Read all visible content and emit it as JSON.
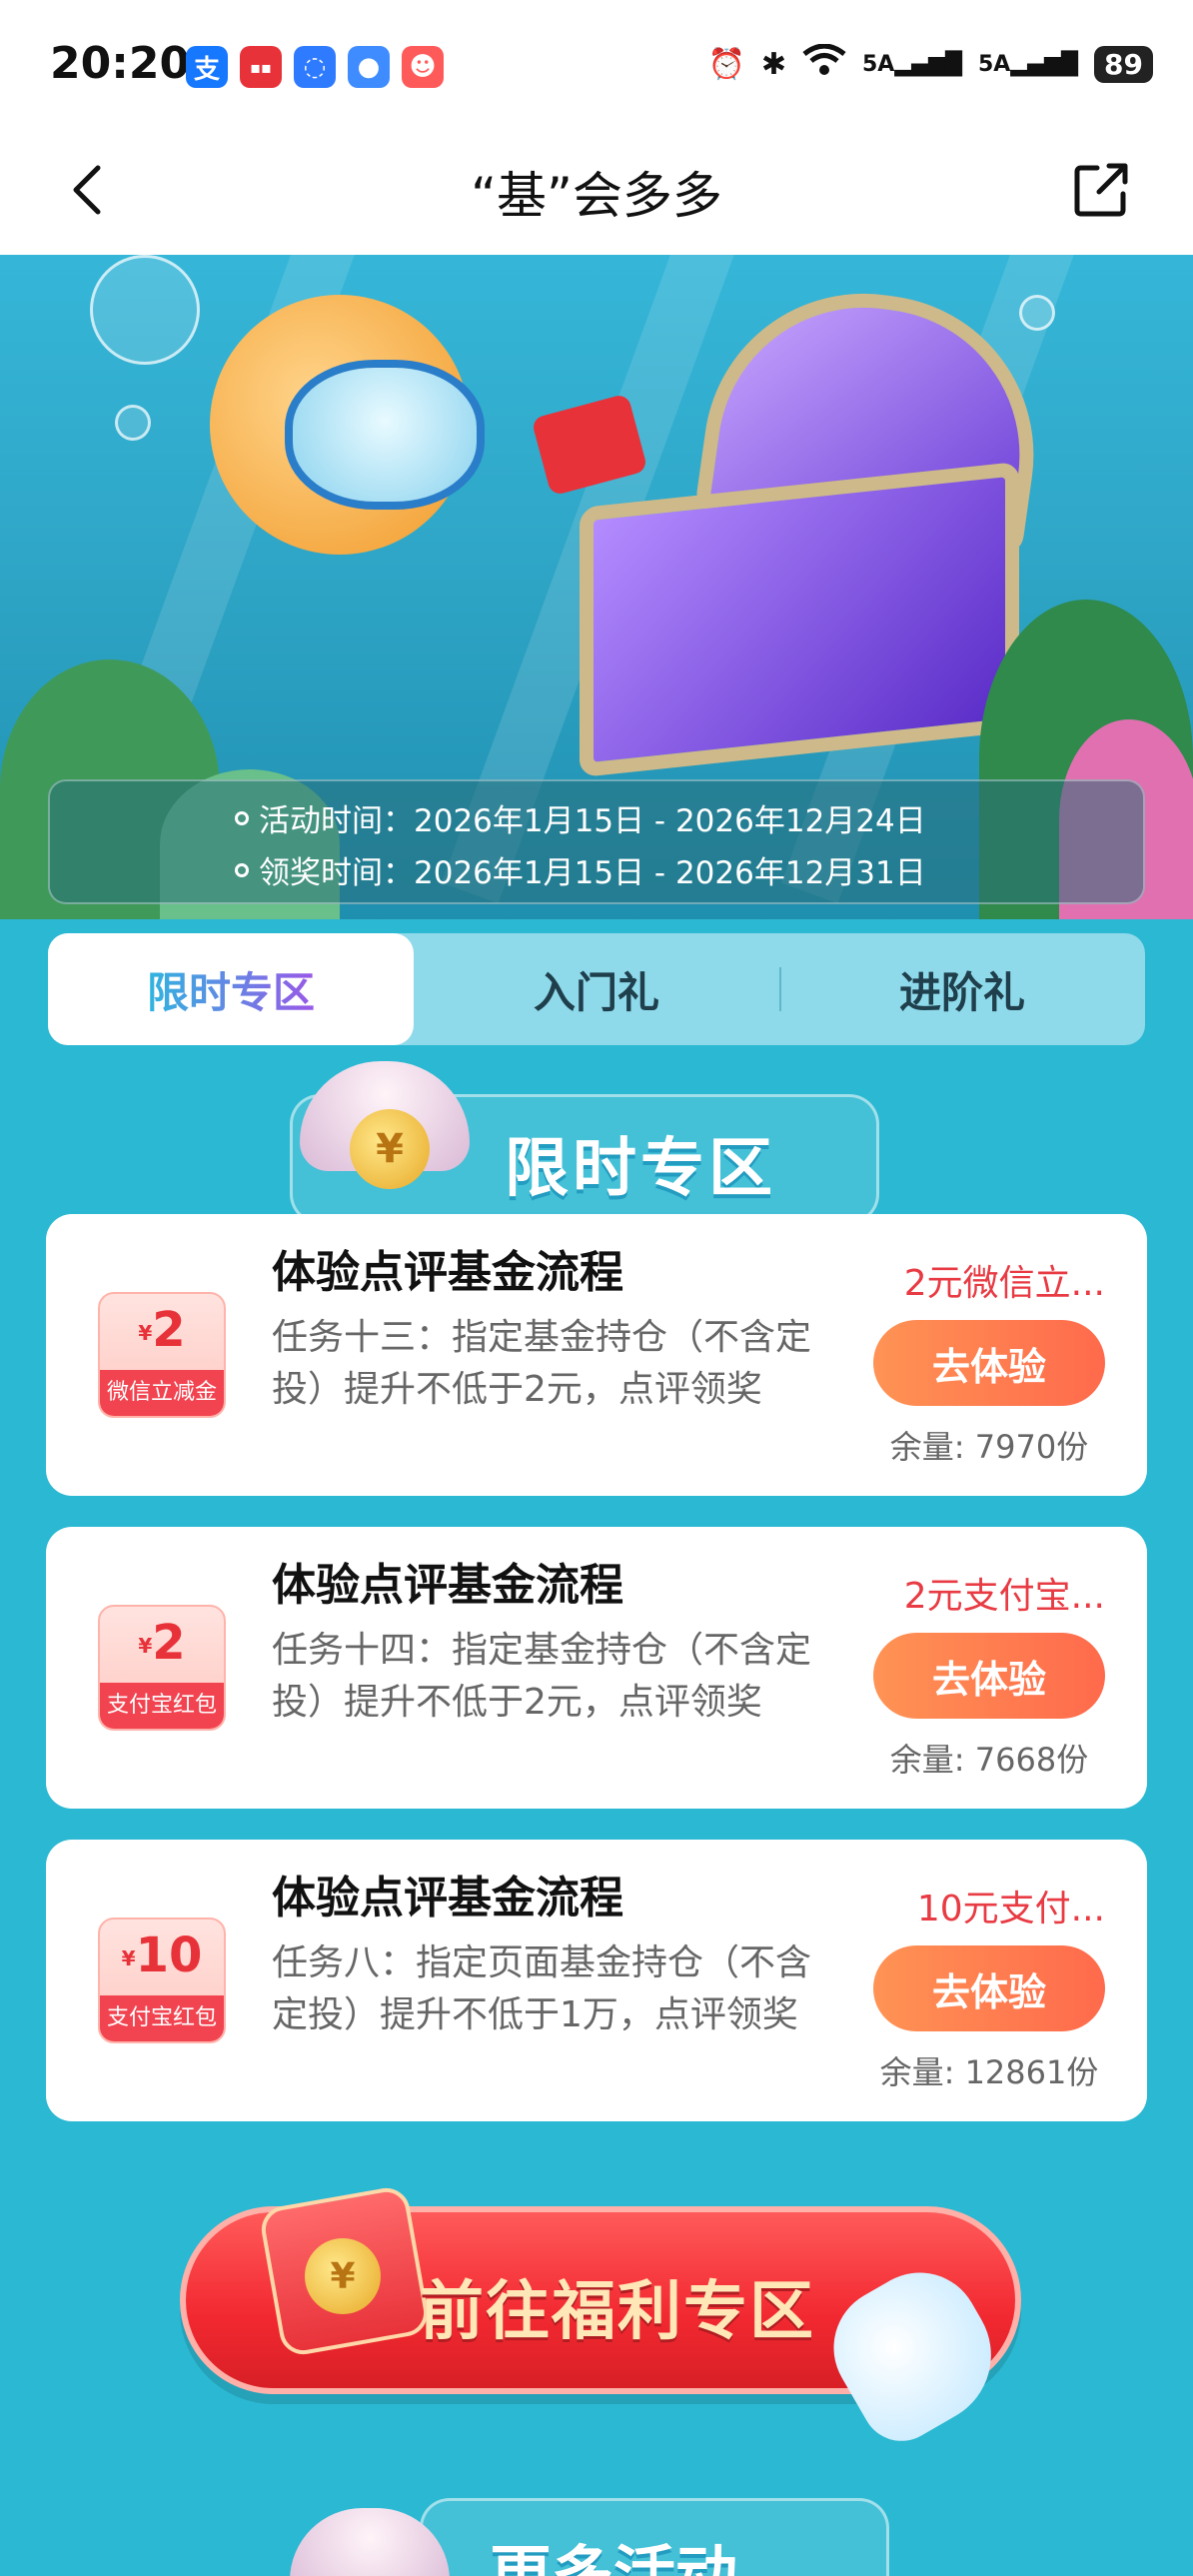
{
  "status_bar": {
    "time": "20:20",
    "battery": "89",
    "signal_1": "5A",
    "signal_2": "5A"
  },
  "nav": {
    "title": "“基”会多多"
  },
  "activity": {
    "activity_time": "活动时间：2026年1月15日 - 2026年12月24日",
    "claim_time": "领奖时间：2026年1月15日 - 2026年12月31日"
  },
  "tabs": [
    {
      "label": "限时专区",
      "active": true
    },
    {
      "label": "入门礼",
      "active": false
    },
    {
      "label": "进阶礼",
      "active": false
    }
  ],
  "section": {
    "title": "限时专区"
  },
  "tasks": [
    {
      "coupon_amount": "2",
      "coupon_currency": "¥",
      "coupon_label": "微信立减金",
      "title": "体验点评基金流程",
      "description": "任务十三：指定基金持仓（不含定投）提升不低于2元，点评领奖",
      "reward": "2元微信立...",
      "button": "去体验",
      "stock": "余量: 7970份"
    },
    {
      "coupon_amount": "2",
      "coupon_currency": "¥",
      "coupon_label": "支付宝红包",
      "title": "体验点评基金流程",
      "description": "任务十四：指定基金持仓（不含定投）提升不低于2元，点评领奖",
      "reward": "2元支付宝...",
      "button": "去体验",
      "stock": "余量: 7668份"
    },
    {
      "coupon_amount": "10",
      "coupon_currency": "¥",
      "coupon_label": "支付宝红包",
      "title": "体验点评基金流程",
      "description": "任务八：指定页面基金持仓（不含定投）提升不低于1万，点评领奖",
      "reward": "10元支付...",
      "button": "去体验",
      "stock": "余量: 12861份"
    }
  ],
  "welfare_button": {
    "label": "前往福利专区",
    "coin": "¥"
  },
  "more": {
    "title": "更多活动"
  },
  "colors": {
    "page_bg": "#2bb8d2",
    "accent_red": "#e83b43",
    "cta_orange": "#ff7a4f",
    "tab_active": "#3aa9e0"
  },
  "icons": [
    "back-arrow-icon",
    "share-icon",
    "alarm-icon",
    "bluetooth-icon",
    "wifi-icon",
    "signal-icon",
    "battery-icon"
  ]
}
